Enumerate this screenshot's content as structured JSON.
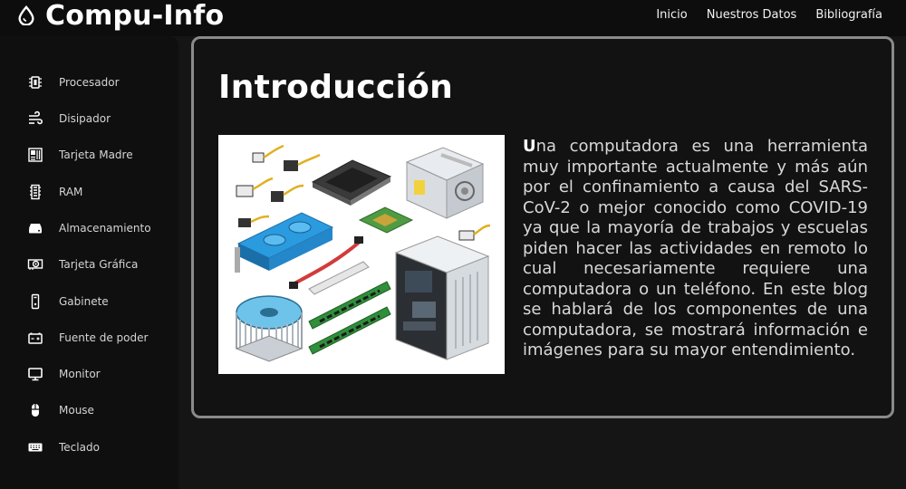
{
  "header": {
    "brand": "Compu-Info",
    "nav": [
      "Inicio",
      "Nuestros Datos",
      "Bibliografía"
    ]
  },
  "sidebar": {
    "items": [
      {
        "label": "Procesador",
        "icon": "cpu-icon"
      },
      {
        "label": "Disipador",
        "icon": "wind-icon"
      },
      {
        "label": "Tarjeta Madre",
        "icon": "motherboard-icon"
      },
      {
        "label": "RAM",
        "icon": "memory-icon"
      },
      {
        "label": "Almacenamiento",
        "icon": "hdd-icon"
      },
      {
        "label": "Tarjeta Gráfica",
        "icon": "gpu-icon"
      },
      {
        "label": "Gabinete",
        "icon": "tower-icon"
      },
      {
        "label": "Fuente de poder",
        "icon": "battery-icon"
      },
      {
        "label": "Monitor",
        "icon": "monitor-icon"
      },
      {
        "label": "Mouse",
        "icon": "mouse-icon"
      },
      {
        "label": "Teclado",
        "icon": "keyboard-icon"
      }
    ]
  },
  "main": {
    "title": "Introducción",
    "paragraph_first_letter": "U",
    "paragraph_rest": "na computadora es una herramienta muy importante actualmente y más aún por el confinamiento a causa del SARS-CoV-2 o mejor conocido como COVID-19 ya que la mayoría de trabajos y escuelas piden hacer las actividades en remoto lo cual necesariamente requiere una computadora o un teléfono. En este blog se hablará de los componentes de una computadora, se mostrará información e imágenes para su mayor entendimiento."
  },
  "colors": {
    "background": "#151515",
    "header_bg": "#0d0d0d",
    "sidebar_bg": "#0f0f0f",
    "card_border": "#8a8a8a",
    "text": "#ffffff"
  }
}
